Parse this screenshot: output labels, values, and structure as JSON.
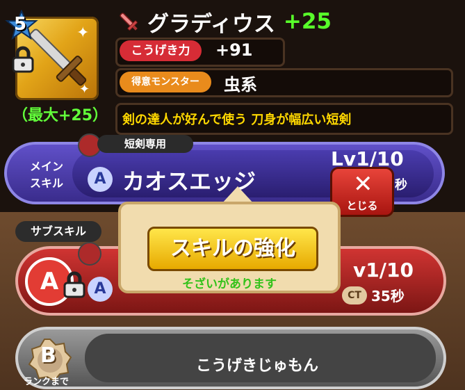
{
  "weapon": {
    "star_level": "5",
    "name": "グラディウス",
    "plus": "+25",
    "max_label": "（最大+25）",
    "stats": [
      {
        "label": "こうげき力",
        "value": "+91"
      },
      {
        "label": "得意モンスター",
        "value": "虫系"
      }
    ],
    "description": "剣の達人が好んで使う 刀身が幅広い短剣"
  },
  "main_skill": {
    "section_label": "メイン スキル",
    "weapon_tag": "短剣専用",
    "rank": "A",
    "name": "カオスエッジ",
    "level": "Lv1/10",
    "ct_suffix": "秒"
  },
  "close_button": {
    "label": "とじる"
  },
  "sub_skill": {
    "section_label": "サブスキル",
    "rank": "A",
    "level": "v1/10",
    "ct_label": "CT",
    "ct_value": "35秒"
  },
  "b_skill": {
    "rank": "B",
    "name": "こうげきじゅもん",
    "rank_label": "ランクまで"
  },
  "popup": {
    "button_label": "スキルの強化",
    "message": "そざいがあります"
  },
  "colors": {
    "plus_green": "#58ff2a",
    "desc_yellow": "#ffd800",
    "attack_pill": "#d62c36",
    "monster_pill": "#e98b1c"
  }
}
